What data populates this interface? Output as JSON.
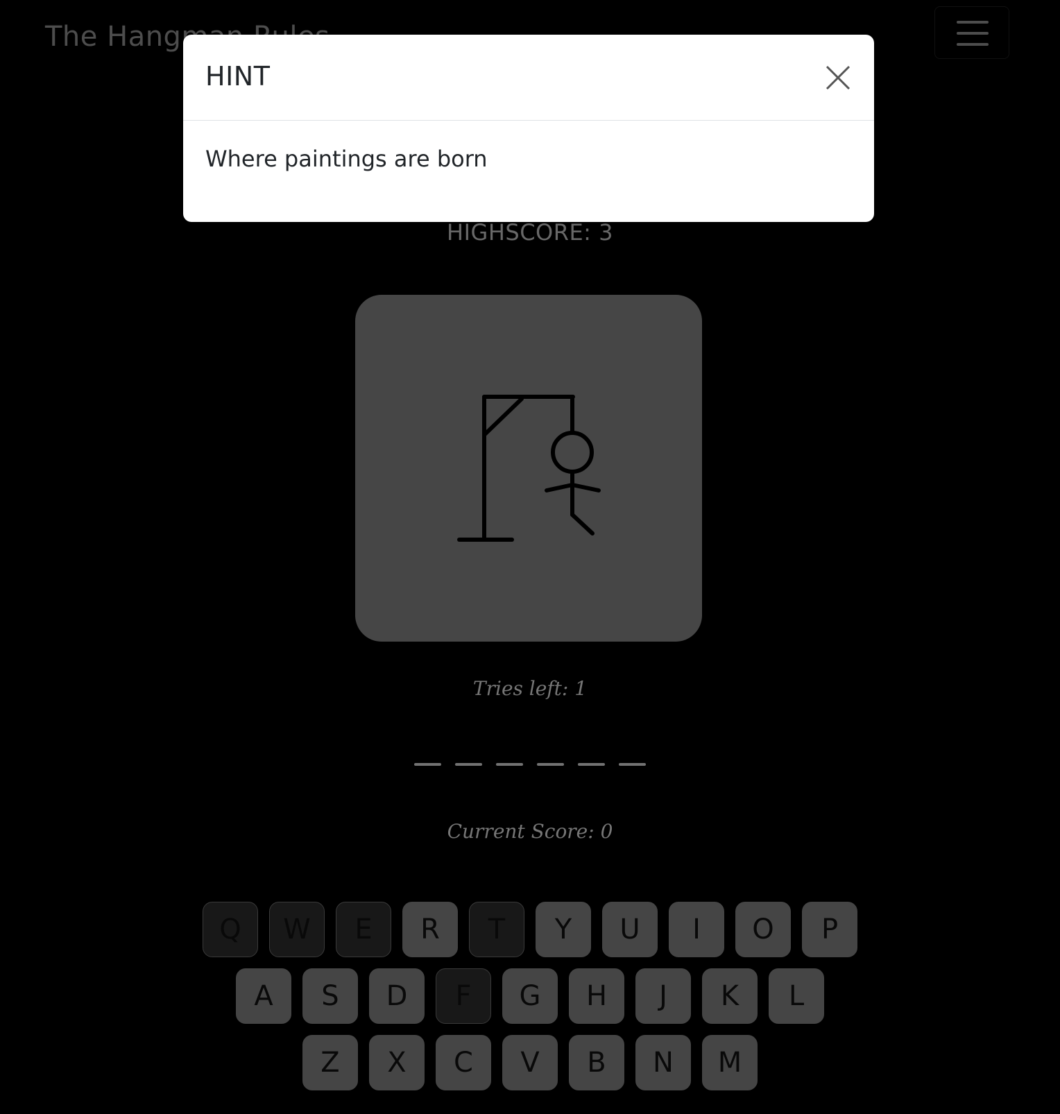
{
  "navbar": {
    "brand": "The Hangman Rules"
  },
  "game": {
    "highscore_text": "HIGHSCORE: 3",
    "tries_text": "Tries left: 1",
    "current_score_text": "Current Score: 0",
    "word_blanks": [
      "",
      "",
      "",
      "",
      "",
      ""
    ]
  },
  "modal": {
    "title": "HINT",
    "body": "Where paintings are born"
  },
  "keyboard": {
    "rows": [
      [
        "Q",
        "W",
        "E",
        "R",
        "T",
        "Y",
        "U",
        "I",
        "O",
        "P"
      ],
      [
        "A",
        "S",
        "D",
        "F",
        "G",
        "H",
        "J",
        "K",
        "L"
      ],
      [
        "Z",
        "X",
        "C",
        "V",
        "B",
        "N",
        "M"
      ]
    ],
    "used": [
      "Q",
      "W",
      "E",
      "T",
      "F"
    ]
  },
  "colors": {
    "background": "#000000",
    "card": "#808080",
    "key": "#7f7f7f",
    "key_used": "#2d2d2d",
    "modal": "#ffffff"
  }
}
